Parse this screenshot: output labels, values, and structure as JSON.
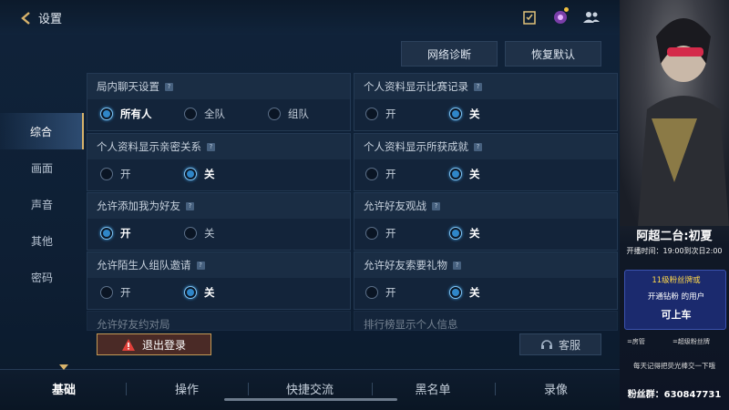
{
  "header": {
    "back_label": "设置"
  },
  "top_buttons": {
    "diagnose": "网络诊断",
    "reset": "恢复默认"
  },
  "left_nav": [
    {
      "label": "综合",
      "active": true
    },
    {
      "label": "画面"
    },
    {
      "label": "声音"
    },
    {
      "label": "其他"
    },
    {
      "label": "密码"
    }
  ],
  "panels": {
    "chat": {
      "title": "局内聊天设置",
      "opts": [
        "所有人",
        "全队",
        "组队"
      ],
      "selected": "所有人"
    },
    "match_record": {
      "title": "个人资料显示比赛记录",
      "opts": [
        "开",
        "关"
      ],
      "selected": "关"
    },
    "intimacy": {
      "title": "个人资料显示亲密关系",
      "opts": [
        "开",
        "关"
      ],
      "selected": "关"
    },
    "achievements": {
      "title": "个人资料显示所获成就",
      "opts": [
        "开",
        "关"
      ],
      "selected": "关"
    },
    "add_friend": {
      "title": "允许添加我为好友",
      "opts": [
        "开",
        "关"
      ],
      "selected": "开"
    },
    "friend_spectate": {
      "title": "允许好友观战",
      "opts": [
        "开",
        "关"
      ],
      "selected": "关"
    },
    "stranger_invite": {
      "title": "允许陌生人组队邀请",
      "opts": [
        "开",
        "关"
      ],
      "selected": "关"
    },
    "friend_gift": {
      "title": "允许好友索要礼物",
      "opts": [
        "开",
        "关"
      ],
      "selected": "关"
    },
    "friend_duel": {
      "title": "允许好友约对局"
    },
    "ranking": {
      "title": "排行榜显示个人信息"
    }
  },
  "logout_label": "退出登录",
  "service_label": "客服",
  "bottom_tabs": [
    {
      "label": "基础",
      "active": true
    },
    {
      "label": "操作"
    },
    {
      "label": "快捷交流"
    },
    {
      "label": "黑名单"
    },
    {
      "label": "录像"
    }
  ],
  "stream": {
    "title": "阿超二台:初夏",
    "schedule": "开播时间：19:00到次日2:00",
    "fan_line1": "11级粉丝牌或",
    "fan_line2": "开通钻粉 的用户",
    "fan_line3": "可上车",
    "legend1": "=房管",
    "legend2": "=超级粉丝牌",
    "note": "每天记得把荧光棒交一下哦",
    "fan_group": "粉丝群：630847731"
  },
  "colors": {
    "accent_gold": "#d8b36b",
    "radio_on": "#2f86c8",
    "logout_bg": "#4a2a26"
  }
}
